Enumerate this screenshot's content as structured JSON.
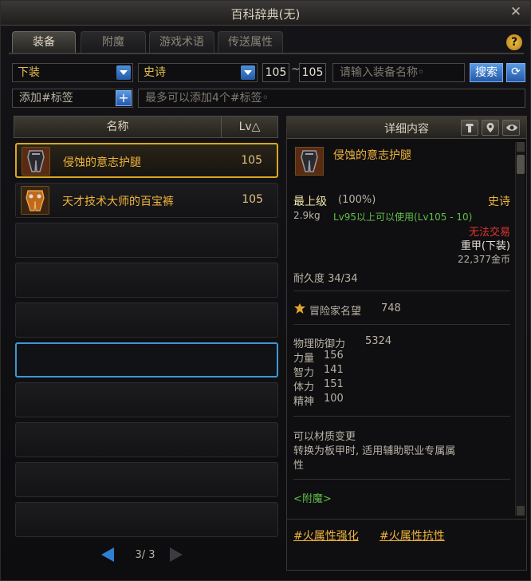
{
  "window": {
    "title": "百科辞典(无)",
    "close_glyph": "✕"
  },
  "tabs": [
    {
      "label": "装备"
    },
    {
      "label": "附魔"
    },
    {
      "label": "游戏术语"
    },
    {
      "label": "传送属性"
    }
  ],
  "help_glyph": "?",
  "filters": {
    "slot": "下装",
    "rarity": "史诗",
    "level_min": "105",
    "level_sep": "~",
    "level_max": "105",
    "name_placeholder": "请输入装备名称◦",
    "search_label": "搜索",
    "refresh_glyph": "⟳"
  },
  "tags": {
    "label": "添加#标签",
    "plus": "+",
    "hint": "最多可以添加4个#标签◦"
  },
  "list": {
    "col_name": "名称",
    "col_lv": "Lv△",
    "items": [
      {
        "name": "侵蚀的意志护腿",
        "lv": "105",
        "selected": true
      },
      {
        "name": "天才技术大师的百宝裤",
        "lv": "105",
        "selected": false
      }
    ],
    "pager_text": "3/ 3"
  },
  "detail": {
    "header": "详细内容",
    "name": "侵蚀的意志护腿",
    "grade": "最上级",
    "grade_pct": "(100%)",
    "rarity": "史诗",
    "weight": "2.9kg",
    "level_req": "Lv95以上可以使用(Lv105 - 10)",
    "trade": "无法交易",
    "type": "重甲(下装)",
    "price": "22,377金币",
    "durability": "耐久度 34/34",
    "fame_label": "冒险家名望",
    "fame_value": "748",
    "stats": [
      {
        "label": "物理防御力",
        "value": "5324"
      },
      {
        "label": "力量",
        "value": "156"
      },
      {
        "label": "智力",
        "value": "141"
      },
      {
        "label": "体力",
        "value": "151"
      },
      {
        "label": "精神",
        "value": "100"
      }
    ],
    "material_change": "可以材质变更",
    "convert_line1": "转换为板甲时, 适用辅助职业专属属",
    "convert_line2": "性",
    "enchant_header": "<附魔>",
    "enchant_links": [
      "#火属性强化",
      "#火属性抗性"
    ]
  },
  "colors": {
    "accent_gold": "#f0b43a",
    "accent_blue": "#3e97d4",
    "green": "#5fbf45",
    "red": "#e0362d"
  }
}
